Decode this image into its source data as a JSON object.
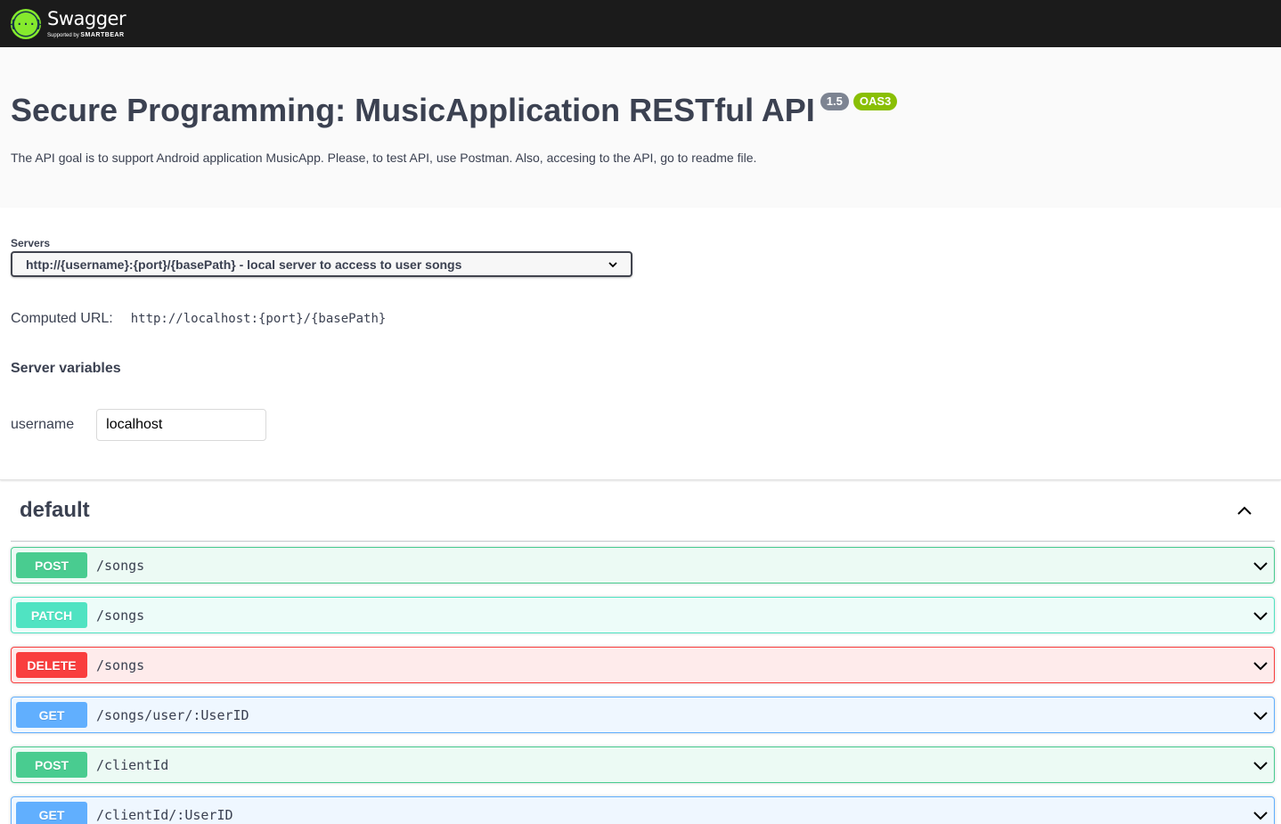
{
  "topbar": {
    "logo_name": "Swagger",
    "logo_sub_prefix": "Supported by",
    "logo_sub_brand": "SMARTBEAR",
    "logo_color": "#85ea2d"
  },
  "info": {
    "title": "Secure Programming: MusicApplication RESTful API",
    "version": "1.5",
    "oas_badge": "OAS3",
    "description": "The API goal is to support Android application MusicApp. Please, to test API, use Postman. Also, accesing to the API, go to readme file."
  },
  "servers": {
    "label": "Servers",
    "selected": "http://{username}:{port}/{basePath} - local server to access to user songs",
    "computed_label": "Computed URL:",
    "computed_url": "http://localhost:{port}/{basePath}",
    "variables_title": "Server variables",
    "variables": [
      {
        "name": "username",
        "value": "localhost"
      }
    ]
  },
  "tag": {
    "name": "default"
  },
  "operations": [
    {
      "method": "POST",
      "path": "/songs"
    },
    {
      "method": "PATCH",
      "path": "/songs"
    },
    {
      "method": "DELETE",
      "path": "/songs"
    },
    {
      "method": "GET",
      "path": "/songs/user/:UserID"
    },
    {
      "method": "POST",
      "path": "/clientId"
    },
    {
      "method": "GET",
      "path": "/clientId/:UserID"
    }
  ],
  "method_colors": {
    "POST": "#49cc90",
    "PATCH": "#50e3c2",
    "DELETE": "#f93e3e",
    "GET": "#61affe"
  }
}
